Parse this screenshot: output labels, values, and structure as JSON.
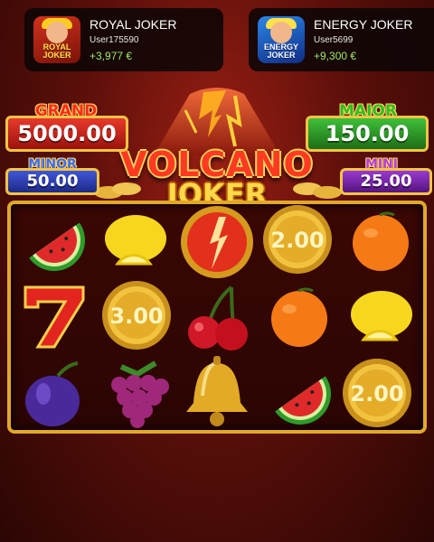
{
  "notifications": [
    {
      "game": "ROYAL JOKER",
      "user": "User175590",
      "amount": "+3,977 €",
      "thumb_text": "ROYAL JOKER"
    },
    {
      "game": "ENERGY JOKER",
      "user": "User5699",
      "amount": "+9,300 €",
      "thumb_text": "ENERGY JOKER"
    }
  ],
  "title": {
    "line1": "VOLCANO",
    "line2": "JOKER"
  },
  "jackpots": {
    "grand": {
      "label": "GRAND",
      "value": "5000.00",
      "color": "#d6231a"
    },
    "major": {
      "label": "MAJOR",
      "value": "150.00",
      "color": "#2c9a2a"
    },
    "minor": {
      "label": "MINOR",
      "value": "50.00",
      "color": "#2f3fb8"
    },
    "mini": {
      "label": "MINI",
      "value": "25.00",
      "color": "#7a2bb0"
    }
  },
  "reels": {
    "columns": 5,
    "rows": 3,
    "symbols": [
      [
        "watermelon-icon",
        "seven-icon",
        "plum-icon"
      ],
      [
        "lemon-icon",
        "coin-icon",
        "grapes-icon"
      ],
      [
        "fire-scatter-icon",
        "cherries-icon",
        "bell-icon"
      ],
      [
        "coin-icon",
        "orange-icon",
        "watermelon-icon"
      ],
      [
        "orange-icon",
        "lemon-icon",
        "coin-icon"
      ]
    ],
    "coin_values": {
      "col1_row2": "3.00",
      "col3_row1": "2.00",
      "col4_row3": "2.00"
    }
  }
}
